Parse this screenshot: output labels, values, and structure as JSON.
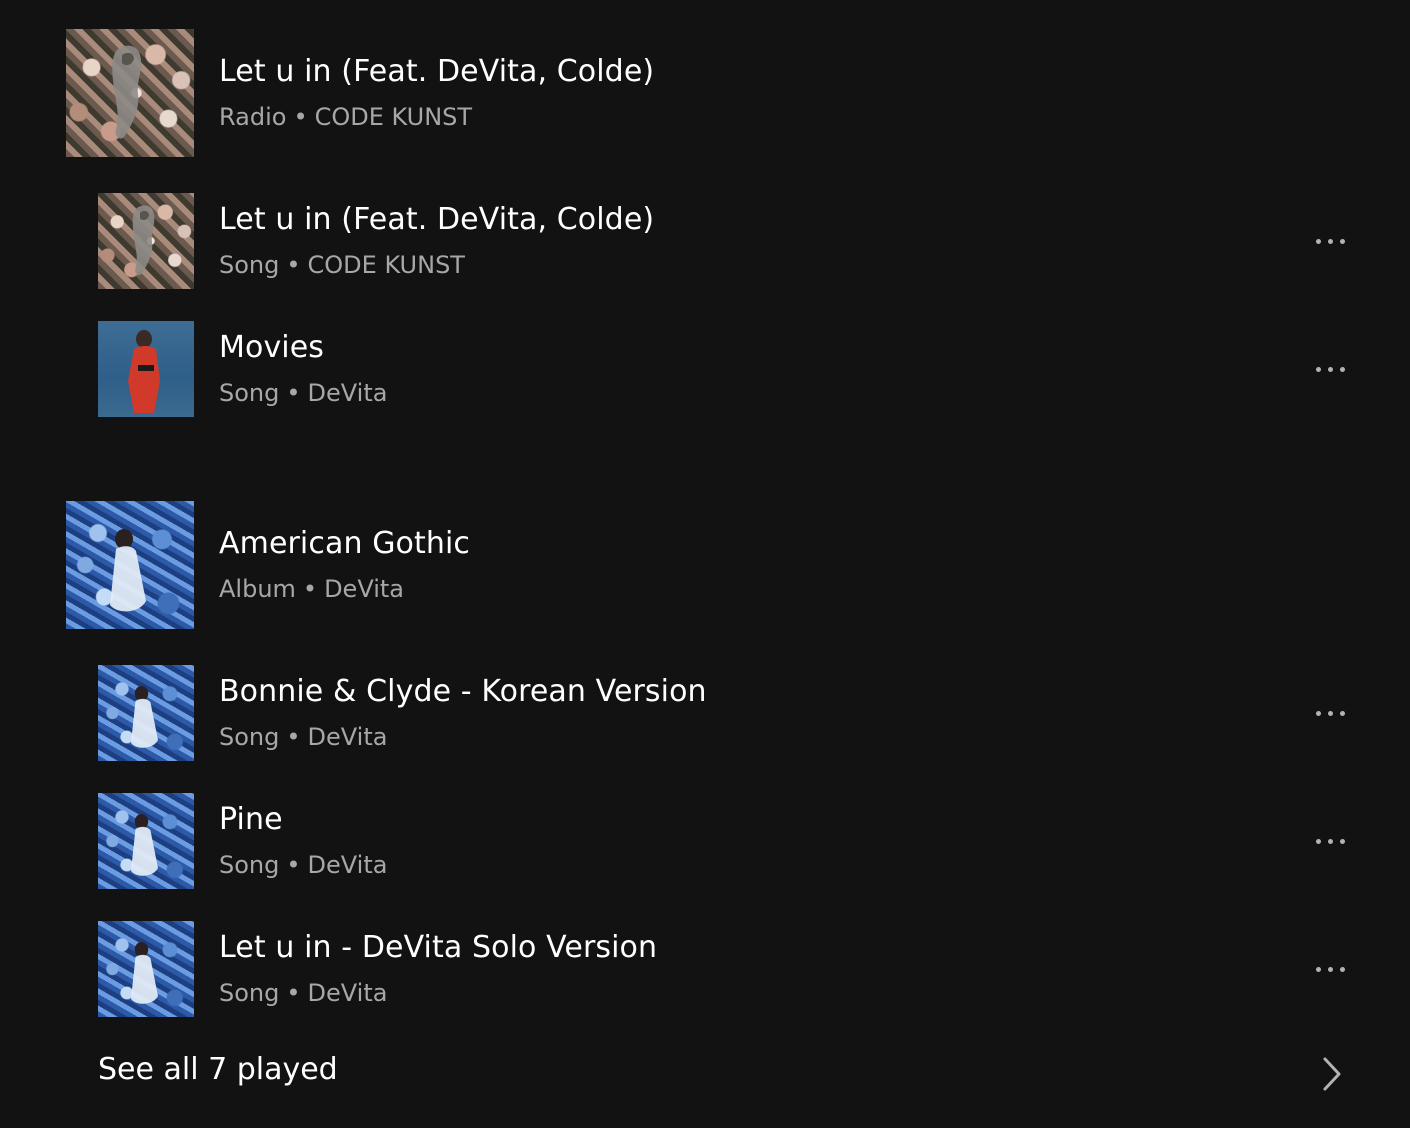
{
  "items": [
    {
      "title": "Let u in (Feat. DeVita, Colde)",
      "type": "Radio",
      "artist": "CODE KUNST",
      "cover": "flower-cover"
    },
    {
      "title": "Let u in (Feat. DeVita, Colde)",
      "type": "Song",
      "artist": "CODE KUNST",
      "cover": "flower-cover"
    },
    {
      "title": "Movies",
      "type": "Song",
      "artist": "DeVita",
      "cover": "movies-cover"
    },
    {
      "title": "American Gothic",
      "type": "Album",
      "artist": "DeVita",
      "cover": "blue-cover"
    },
    {
      "title": "Bonnie & Clyde - Korean Version",
      "type": "Song",
      "artist": "DeVita",
      "cover": "blue-cover"
    },
    {
      "title": "Pine",
      "type": "Song",
      "artist": "DeVita",
      "cover": "blue-cover"
    },
    {
      "title": "Let u in - DeVita Solo Version",
      "type": "Song",
      "artist": "DeVita",
      "cover": "blue-cover"
    }
  ],
  "separator": "•",
  "see_all_label": "See all 7 played",
  "icons": {
    "more": "more-options-icon",
    "chevron": "chevron-right-icon"
  },
  "colors": {
    "background": "#121212",
    "title": "#ffffff",
    "subtitle": "#a7a7a7"
  }
}
